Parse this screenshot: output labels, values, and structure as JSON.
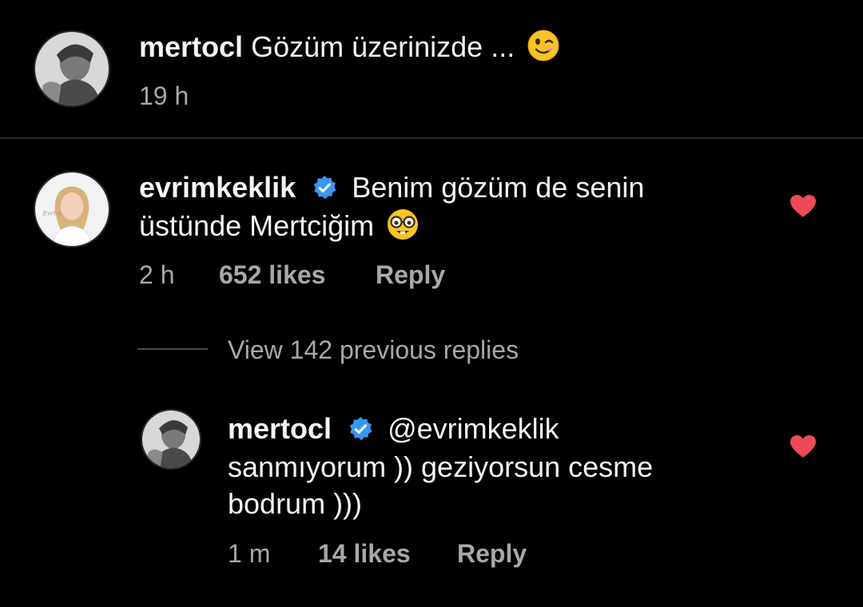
{
  "caption": {
    "username": "mertocl",
    "text": "Gözüm üzerinizde ...",
    "emoji_icon": "winking-face-emoji",
    "time": "19 h"
  },
  "comment": {
    "username": "evrimkeklik",
    "verified_icon": "verified-badge-icon",
    "text_line1": "Benim gözüm de senin",
    "text_line2": "üstünde Mertciğim",
    "emoji_icon": "nerd-face-emoji",
    "time": "2 h",
    "likes": "652 likes",
    "reply_label": "Reply",
    "liked": true
  },
  "view_replies": "View 142 previous replies",
  "reply": {
    "username": "mertocl",
    "verified_icon": "verified-badge-icon",
    "mention": "@evrimkeklik",
    "text_line2": "sanmıyorum )) geziyorsun cesme",
    "text_line3": "bodrum )))",
    "time": "1 m",
    "likes": "14 likes",
    "reply_label": "Reply",
    "liked": true
  },
  "colors": {
    "background": "#000000",
    "text": "#f5f5f5",
    "secondary_text": "#a8a8a8",
    "verified_blue": "#3897f0",
    "heart_red": "#ed4956"
  }
}
